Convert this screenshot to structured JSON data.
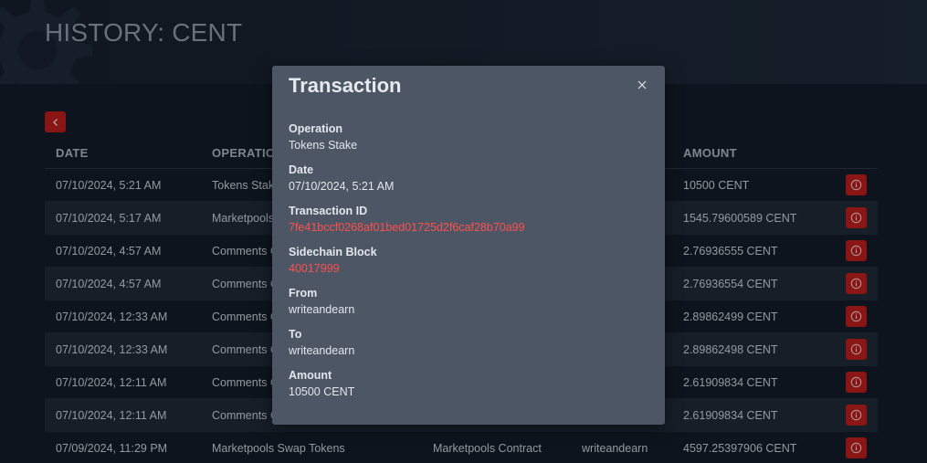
{
  "page": {
    "title": "HISTORY: CENT"
  },
  "table": {
    "headers": [
      "DATE",
      "OPERATION",
      "AMOUNT"
    ],
    "rows": [
      {
        "date": "07/10/2024, 5:21 AM",
        "operation": "Tokens Stak",
        "from": "",
        "to": "",
        "amount": "10500 CENT"
      },
      {
        "date": "07/10/2024, 5:17 AM",
        "operation": "Marketpools",
        "from": "",
        "to": "",
        "amount": "1545.79600589 CENT"
      },
      {
        "date": "07/10/2024, 4:57 AM",
        "operation": "Comments C",
        "from": "",
        "to": "",
        "amount": "2.76936555 CENT"
      },
      {
        "date": "07/10/2024, 4:57 AM",
        "operation": "Comments C",
        "from": "",
        "to": "",
        "amount": "2.76936554 CENT"
      },
      {
        "date": "07/10/2024, 12:33 AM",
        "operation": "Comments C",
        "from": "",
        "to": "",
        "amount": "2.89862499 CENT"
      },
      {
        "date": "07/10/2024, 12:33 AM",
        "operation": "Comments C",
        "from": "",
        "to": "",
        "amount": "2.89862498 CENT"
      },
      {
        "date": "07/10/2024, 12:11 AM",
        "operation": "Comments C",
        "from": "",
        "to": "",
        "amount": "2.61909834 CENT"
      },
      {
        "date": "07/10/2024, 12:11 AM",
        "operation": "Comments C",
        "from": "",
        "to": "",
        "amount": "2.61909834 CENT"
      },
      {
        "date": "07/09/2024, 11:29 PM",
        "operation": "Marketpools Swap Tokens",
        "from": "Marketpools Contract",
        "to": "writeandearn",
        "amount": "4597.25397906 CENT"
      }
    ]
  },
  "modal": {
    "title": "Transaction",
    "fields": [
      {
        "label": "Operation",
        "value": "Tokens Stake"
      },
      {
        "label": "Date",
        "value": "07/10/2024, 5:21 AM"
      },
      {
        "label": "Transaction ID",
        "value": "7fe41bccf0268af01bed01725d2f6caf28b70a99"
      },
      {
        "label": "Sidechain Block",
        "value": "40017999"
      },
      {
        "label": "From",
        "value": "writeandearn"
      },
      {
        "label": "To",
        "value": "writeandearn"
      },
      {
        "label": "Amount",
        "value": "10500 CENT"
      }
    ]
  },
  "icons": {
    "back": "chevron-left-icon",
    "info": "info-circle-icon",
    "close": "close-icon",
    "decor": "gear-icon"
  },
  "colors": {
    "accent": "#b71c1c",
    "link": "#ff4f4f",
    "modal_bg": "#4c5664",
    "page_bg": "#131b27"
  }
}
